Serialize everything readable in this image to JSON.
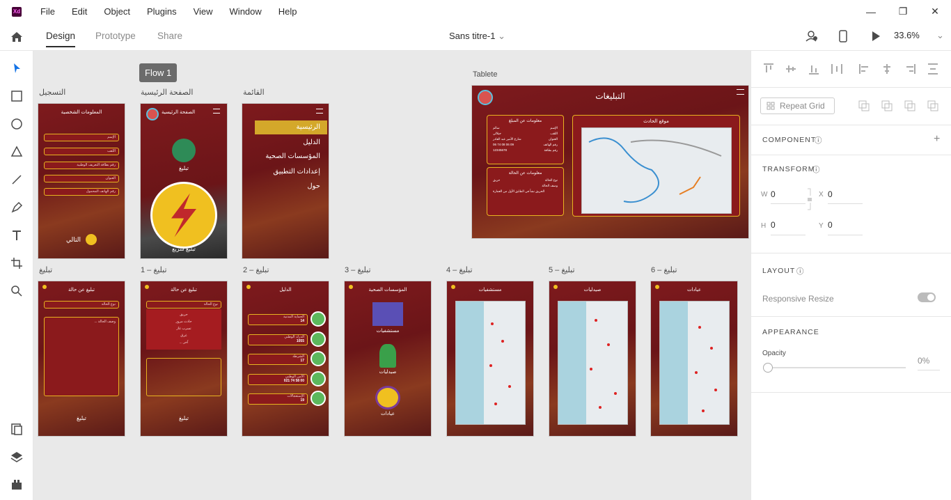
{
  "app": {
    "logo": "Xd"
  },
  "menu": [
    "File",
    "Edit",
    "Object",
    "Plugins",
    "View",
    "Window",
    "Help"
  ],
  "window_controls": {
    "minimize": "—",
    "maximize": "❐",
    "close": "✕"
  },
  "tabs": {
    "design": "Design",
    "prototype": "Prototype",
    "share": "Share"
  },
  "document": {
    "title": "Sans titre-1",
    "chevron": "⌄"
  },
  "zoom": {
    "value": "33.6%",
    "chevron": "⌄"
  },
  "flow_label": "Flow 1",
  "tablet_label": "Tablete",
  "boards_top": {
    "b1": {
      "label": "التسجيل",
      "header": "المعلومات الشخصية",
      "fields": [
        "الإسم",
        "اللقب",
        "رقم بطاقة التعريف الوطنية",
        "العنوان",
        "رقم الهاتف المحمول"
      ],
      "next": "التالي"
    },
    "b2": {
      "label": "الصفحة الرئيسية",
      "header": "الصفحة الرئيسية",
      "report": "تبليغ",
      "quick": "تبليغ سريع"
    },
    "b3": {
      "label": "القائمة",
      "items": [
        "الرئيسية",
        "الدليل",
        "المؤسسات الصحية",
        "إعدادات التطبيق",
        "حول"
      ]
    }
  },
  "tablet": {
    "title": "التبليغات",
    "card1_title": "معلومات عن المبلغ",
    "card1_rows": [
      [
        "الإسم",
        "سالم"
      ],
      [
        "اللقب",
        "جيلالي"
      ],
      [
        "العنوان",
        "شارع الأمير عبد القادر"
      ],
      [
        "رقم الهاتف",
        "06 74 08 06 09"
      ],
      [
        "رقم بطاقة",
        "12345678"
      ]
    ],
    "card2_title": "معلومات عن الحالة",
    "card2_rows": [
      [
        "نوع الحالة",
        "حريق"
      ],
      [
        "وصف الحالة",
        "الحريق نشأ في الطابق الأول من العمارة"
      ]
    ],
    "map_title": "موقع الحادث"
  },
  "boards_bottom": [
    {
      "label": "تبليغ",
      "header": "تبليغ عن حالة",
      "type": "report",
      "select": "نوع الحالة",
      "desc": "... وصف الحالة",
      "footer": "تبليغ"
    },
    {
      "label": "تبليغ – 1",
      "header": "تبليغ عن حالة",
      "type": "dropdown",
      "select": "نوع الحالة",
      "options": [
        "حريق",
        "حادث مرور",
        "تسرب غاز",
        "غرق",
        "... آخر"
      ],
      "footer": "تبليغ"
    },
    {
      "label": "تبليغ – 2",
      "header": "الدليل",
      "type": "directory",
      "entries": [
        [
          "الحماية المدنية",
          "14"
        ],
        [
          "الدرك الوطني",
          "1055"
        ],
        [
          "الشرطة",
          "17"
        ],
        [
          "الأمن الوطني",
          "021 74 58 00"
        ],
        [
          "الإستعجالات",
          "19"
        ]
      ]
    },
    {
      "label": "تبليغ – 3",
      "header": "المؤسسات الصحية",
      "type": "health",
      "items": [
        "مستشفيات",
        "صيدليات",
        "عيادات"
      ]
    },
    {
      "label": "تبليغ – 4",
      "header": "مستشفيات",
      "type": "map"
    },
    {
      "label": "تبليغ – 5",
      "header": "صيدليات",
      "type": "map"
    },
    {
      "label": "تبليغ – 6",
      "header": "عيادات",
      "type": "map"
    }
  ],
  "panel": {
    "repeat_grid": "Repeat Grid",
    "component": "COMPONENT",
    "transform": "TRANSFORM",
    "w_label": "W",
    "w": "0",
    "x_label": "X",
    "x": "0",
    "h_label": "H",
    "h": "0",
    "y_label": "Y",
    "y": "0",
    "layout": "LAYOUT",
    "responsive": "Responsive Resize",
    "appearance": "APPEARANCE",
    "opacity_label": "Opacity",
    "opacity": "0%",
    "info_icon": "ⓘ",
    "plus": "+"
  }
}
